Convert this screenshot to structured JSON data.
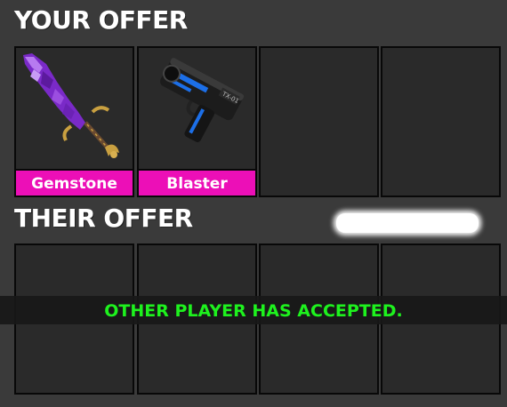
{
  "your_offer": {
    "heading": "YOUR OFFER",
    "slots": [
      {
        "item": "Gemstone",
        "icon": "purple-gem-sword-icon"
      },
      {
        "item": "Blaster",
        "icon": "blaster-gun-icon"
      },
      {
        "item": null
      },
      {
        "item": null
      }
    ]
  },
  "their_offer": {
    "heading": "THEIR OFFER",
    "slots": [
      {
        "item": null
      },
      {
        "item": null
      },
      {
        "item": null
      },
      {
        "item": null
      }
    ]
  },
  "status": {
    "text": "OTHER PLAYER HAS ACCEPTED."
  },
  "colors": {
    "background": "#3a3a3a",
    "slot": "#2a2a2a",
    "item_label": "#ec0fb7",
    "status_text": "#1ef21e"
  }
}
